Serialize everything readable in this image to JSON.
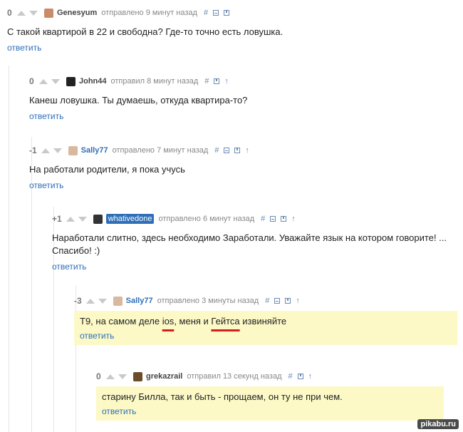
{
  "comments": [
    {
      "rating": "0",
      "author": "Genesyum",
      "time": "отправлено 9 минут назад",
      "text": "С такой квартирой в 22 и свободна? Где-то точно есть ловушка.",
      "reply": "ответить"
    },
    {
      "rating": "0",
      "author": "John44",
      "time": "отправил 8 минут назад",
      "text": "Канеш ловушка. Ты думаешь, откуда квартира-то?",
      "reply": "ответить"
    },
    {
      "rating": "-1",
      "author": "Sally77",
      "time": "отправлено 7 минут назад",
      "text": "На работали родители, я пока учусь",
      "reply": "ответить"
    },
    {
      "rating": "+1",
      "author": "whativedone",
      "time": "отправлено 6 минут назад",
      "text": "Наработали слитно, здесь необходимо Заработали. Уважайте язык на котором говорите! ... Спасибо! :)",
      "reply": "ответить"
    },
    {
      "rating": "-3",
      "author": "Sally77",
      "time": "отправлено 3 минуты назад",
      "text_parts": [
        "Т9, на самом деле ",
        "ios",
        ", меня и ",
        "Гейтса",
        " извиняйте"
      ],
      "reply": "ответить"
    },
    {
      "rating": "0",
      "author": "grekazrail",
      "time": "отправил 13 секунд назад",
      "text": "старину Билла, так и быть - прощаем, он ту не при чем.",
      "reply": "ответить"
    }
  ],
  "icons": {
    "hash": "#",
    "up": "↑"
  },
  "watermark": "pikabu.ru",
  "colors": {
    "accent": "#2e6fb8",
    "highlight_bg": "#fcf9c7",
    "underline": "#d02020"
  }
}
